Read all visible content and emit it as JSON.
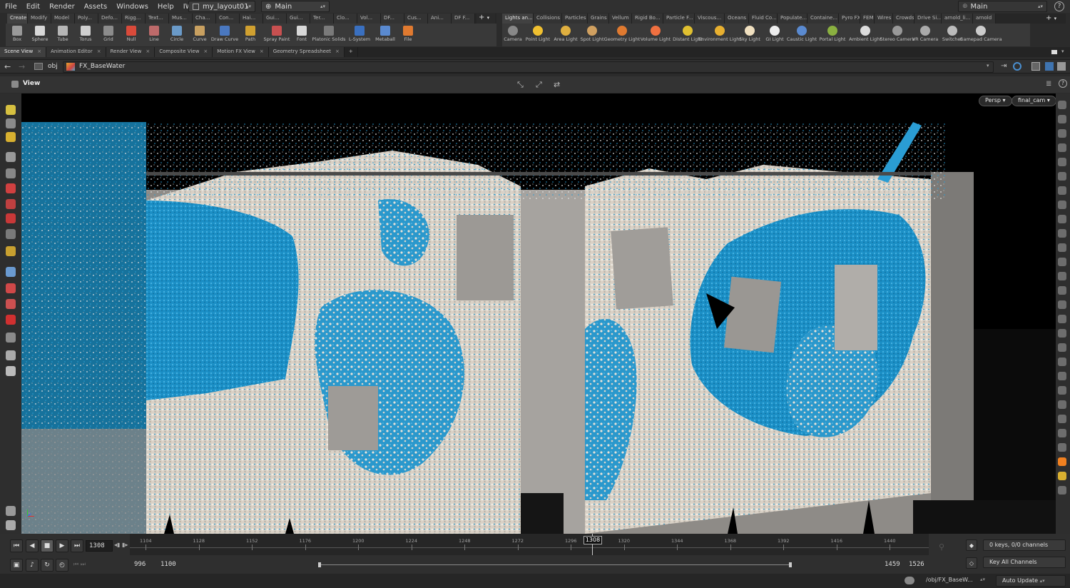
{
  "menubar": {
    "items": [
      "File",
      "Edit",
      "Render",
      "Assets",
      "Windows",
      "Help",
      "IW:effect"
    ],
    "desktop_dropdown": "my_layout01",
    "context_dropdown": "Main",
    "right_dropdown": "Main"
  },
  "left_shelf": {
    "tabs": [
      "Create",
      "Modify",
      "Model",
      "Poly...",
      "Defo...",
      "Rigg...",
      "Text...",
      "Mus...",
      "Cha...",
      "Con...",
      "Hai...",
      "Gui...",
      "Gui...",
      "Ter...",
      "Clo...",
      "Vol...",
      "DF...",
      "Cus...",
      "Ani...",
      "DF F..."
    ],
    "tools": [
      "Box",
      "Sphere",
      "Tube",
      "Torus",
      "Grid",
      "Null",
      "Line",
      "Circle",
      "Curve",
      "Draw Curve",
      "Path",
      "Spray Paint",
      "Font",
      "Platonic Solids",
      "L-System",
      "Metaball",
      "File"
    ]
  },
  "right_shelf": {
    "tabs": [
      "Lights an...",
      "Collisions",
      "Particles",
      "Grains",
      "Vellum",
      "Rigid Bo...",
      "Particle F...",
      "Viscous...",
      "Oceans",
      "Fluid Co...",
      "Populate...",
      "Containe...",
      "Pyro FX",
      "FEM",
      "Wires",
      "Crowds",
      "Drive Si...",
      "arnold_li...",
      "arnold"
    ],
    "tools": [
      "Camera",
      "Point Light",
      "Area Light",
      "Spot Light",
      "Geometry Light",
      "Volume Light",
      "Distant Light",
      "Environment Light",
      "Sky Light",
      "GI Light",
      "Caustic Light",
      "Portal Light",
      "Ambient Light",
      "Stereo Camera",
      "VR Camera",
      "Switcher",
      "Gamepad Camera"
    ]
  },
  "pane_tabs": [
    "Scene View",
    "Animation Editor",
    "Render View",
    "Composite View",
    "Motion FX View",
    "Geometry Spreadsheet"
  ],
  "path": {
    "root": "obj",
    "node": "FX_BaseWater"
  },
  "viewer": {
    "label": "View",
    "projection": "Persp",
    "camera": "final_cam"
  },
  "timeline": {
    "current_frame": "1308",
    "range_start": "996",
    "range_end_visible": "1100",
    "range_start_right": "1459",
    "range_end": "1526",
    "ticks": [
      "1104",
      "1128",
      "1152",
      "1176",
      "1200",
      "1224",
      "1248",
      "1272",
      "1296",
      "1320",
      "1344",
      "1368",
      "1392",
      "1416",
      "1440"
    ],
    "playhead_label": "1308",
    "keys_channels": "0 keys, 0/0 channels",
    "key_all": "Key All Channels"
  },
  "statusbar": {
    "path": "/obj/FX_BaseW...",
    "update_mode": "Auto Update"
  },
  "colors": {
    "water_blue": "#1a8fc4",
    "foam_white": "#e6ddd0",
    "wall_grey": "#8d8a86",
    "accent_orange": "#f0a020"
  }
}
